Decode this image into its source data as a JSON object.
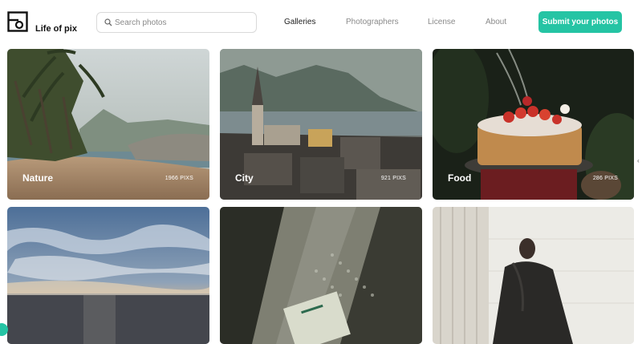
{
  "brand": {
    "name": "Life of pix"
  },
  "search": {
    "placeholder": "Search photos"
  },
  "nav": {
    "galleries": "Galleries",
    "photographers": "Photographers",
    "license": "License",
    "about": "About"
  },
  "submit_button": "Submit your photos",
  "colors": {
    "accent": "#25c4a4"
  },
  "galleries": [
    {
      "title": "Nature",
      "count": "1966 PIXS"
    },
    {
      "title": "City",
      "count": "921 PIXS"
    },
    {
      "title": "Food",
      "count": "286 PIXS"
    }
  ]
}
